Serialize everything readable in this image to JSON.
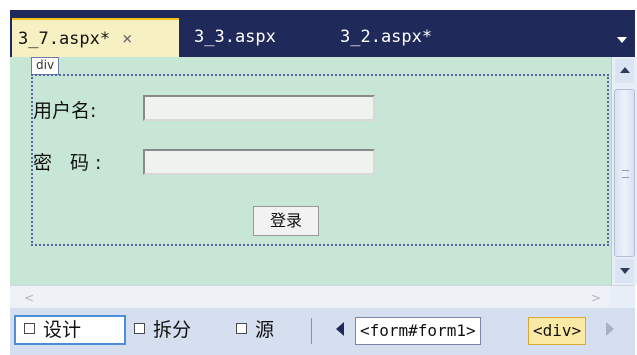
{
  "tabs": [
    {
      "label": "3_7.aspx*",
      "close": "×",
      "active": true
    },
    {
      "label": "3_3.aspx",
      "active": false
    },
    {
      "label": "3_2.aspx*",
      "active": false
    }
  ],
  "design": {
    "div_tag": "div",
    "username_label": "用户名:",
    "password_label": "密 码:",
    "username_value": "",
    "password_value": "",
    "login_button": "登录"
  },
  "view_tabs": [
    {
      "label": "设计",
      "active": true
    },
    {
      "label": "拆分",
      "active": false
    },
    {
      "label": "源",
      "active": false
    }
  ],
  "breadcrumbs": [
    "<form#form1>",
    "<div>"
  ],
  "icons": {
    "tab_dropdown": "chevron-down-icon",
    "scroll_up": "arrow-up-icon",
    "scroll_down": "arrow-down-icon",
    "scroll_left": "arrow-left-icon",
    "scroll_right": "arrow-right-icon",
    "nav_prev": "caret-left-icon",
    "nav_next": "caret-right-icon"
  },
  "colors": {
    "tab_strip": "#1f2a5b",
    "active_tab": "#f7f0c2",
    "design_surface": "#c7e6d6",
    "div_border": "#5566aa",
    "bottom_bar": "#d6dff0",
    "active_view_border": "#4b8fd9",
    "selected_crumb": "#fbe9a6"
  }
}
